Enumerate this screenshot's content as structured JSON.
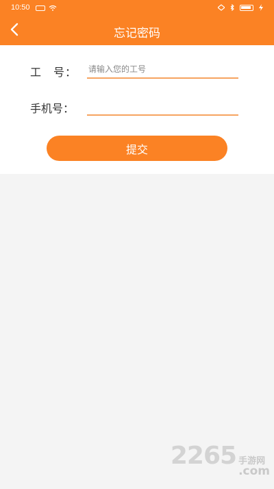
{
  "status": {
    "time": "10:50"
  },
  "header": {
    "title": "忘记密码"
  },
  "form": {
    "id_label": "工　号：",
    "id_placeholder": "请输入您的工号",
    "phone_label": "手机号：",
    "phone_placeholder": "",
    "submit_label": "提交"
  },
  "watermark": {
    "number": "2265",
    "site_cn": "手游网",
    "site_en": ".com"
  },
  "colors": {
    "accent": "#fb8224",
    "underline": "#f6a35f",
    "background": "#f4f4f4"
  },
  "icons": [
    "sim-card-icon",
    "wifi-icon",
    "signal-icon",
    "bluetooth-icon",
    "battery-icon",
    "charging-icon",
    "back-arrow-icon"
  ]
}
